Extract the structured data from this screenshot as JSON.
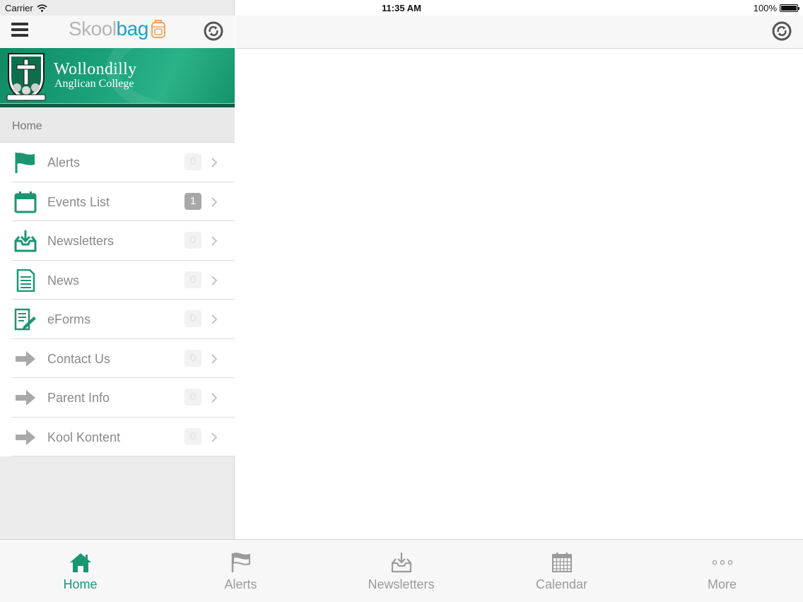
{
  "status_bar": {
    "carrier": "Carrier",
    "time": "11:35 AM",
    "battery": "100%"
  },
  "app": {
    "logo_part1": "Skool",
    "logo_part2": "bag",
    "brand_color": "#1f9fc6",
    "accent_color": "#1a9673"
  },
  "banner": {
    "school_line1": "Wollondilly",
    "school_line2": "Anglican College"
  },
  "sidebar": {
    "section_title": "Home",
    "items": [
      {
        "label": "Alerts",
        "icon": "flag-icon",
        "badge": "0",
        "badge_active": false
      },
      {
        "label": "Events List",
        "icon": "calendar-icon",
        "badge": "1",
        "badge_active": true
      },
      {
        "label": "Newsletters",
        "icon": "inbox-download-icon",
        "badge": "0",
        "badge_active": false
      },
      {
        "label": "News",
        "icon": "document-icon",
        "badge": "0",
        "badge_active": false
      },
      {
        "label": "eForms",
        "icon": "form-pencil-icon",
        "badge": "0",
        "badge_active": false
      },
      {
        "label": "Contact Us",
        "icon": "arrow-right-icon",
        "badge": "0",
        "badge_active": false
      },
      {
        "label": "Parent Info",
        "icon": "arrow-right-icon",
        "badge": "0",
        "badge_active": false
      },
      {
        "label": "Kool Kontent",
        "icon": "arrow-right-icon",
        "badge": "0",
        "badge_active": false
      }
    ]
  },
  "tabbar": {
    "tabs": [
      {
        "label": "Home",
        "icon": "home-icon",
        "active": true
      },
      {
        "label": "Alerts",
        "icon": "flag-icon",
        "active": false
      },
      {
        "label": "Newsletters",
        "icon": "inbox-download-icon",
        "active": false
      },
      {
        "label": "Calendar",
        "icon": "calendar-grid-icon",
        "active": false
      },
      {
        "label": "More",
        "icon": "more-dots-icon",
        "active": false
      }
    ]
  }
}
